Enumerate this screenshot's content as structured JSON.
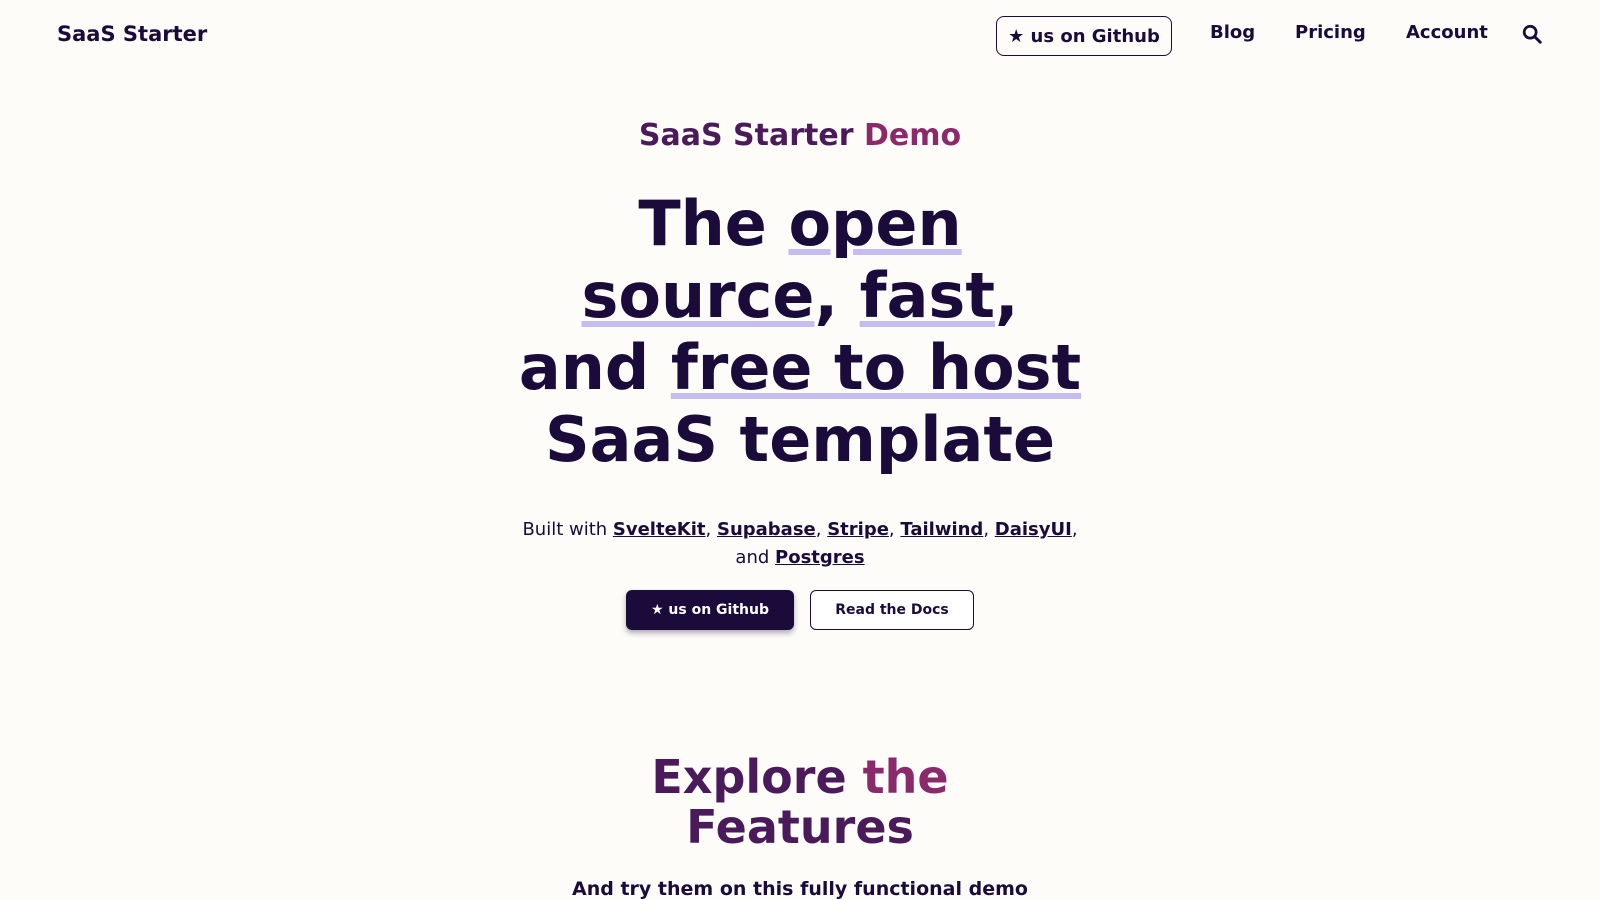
{
  "navbar": {
    "brand": "SaaS Starter",
    "github_label": "★ us on Github",
    "links": [
      "Blog",
      "Pricing",
      "Account"
    ],
    "search_icon": "search-icon"
  },
  "hero": {
    "demo_title_part1": "SaaS Starter ",
    "demo_title_part2": "Demo",
    "headline": {
      "w1": "The ",
      "w2": "open",
      "w3": "source",
      "w4": ", ",
      "w5": "fast",
      "w6": ",",
      "w7": "and ",
      "w8": "free to host",
      "w9": "SaaS template"
    },
    "built_with_prefix": "Built with ",
    "technologies": [
      "SvelteKit",
      "Supabase",
      "Stripe",
      "Tailwind",
      "DaisyUI"
    ],
    "and_label": "and ",
    "last_technology": "Postgres",
    "primary_button": "★ us on Github",
    "secondary_button": "Read the Docs"
  },
  "features": {
    "title_part1": "Explore ",
    "title_part2": "the",
    "title_part3": "Features",
    "subtitle": "And try them on this fully functional demo"
  },
  "colors": {
    "primary": "#1a0b3a",
    "gradient_start": "#4a1a5a",
    "gradient_end": "#8a2a6a",
    "highlight_underline": "#c5bdf0",
    "background": "#fdfcf8"
  }
}
